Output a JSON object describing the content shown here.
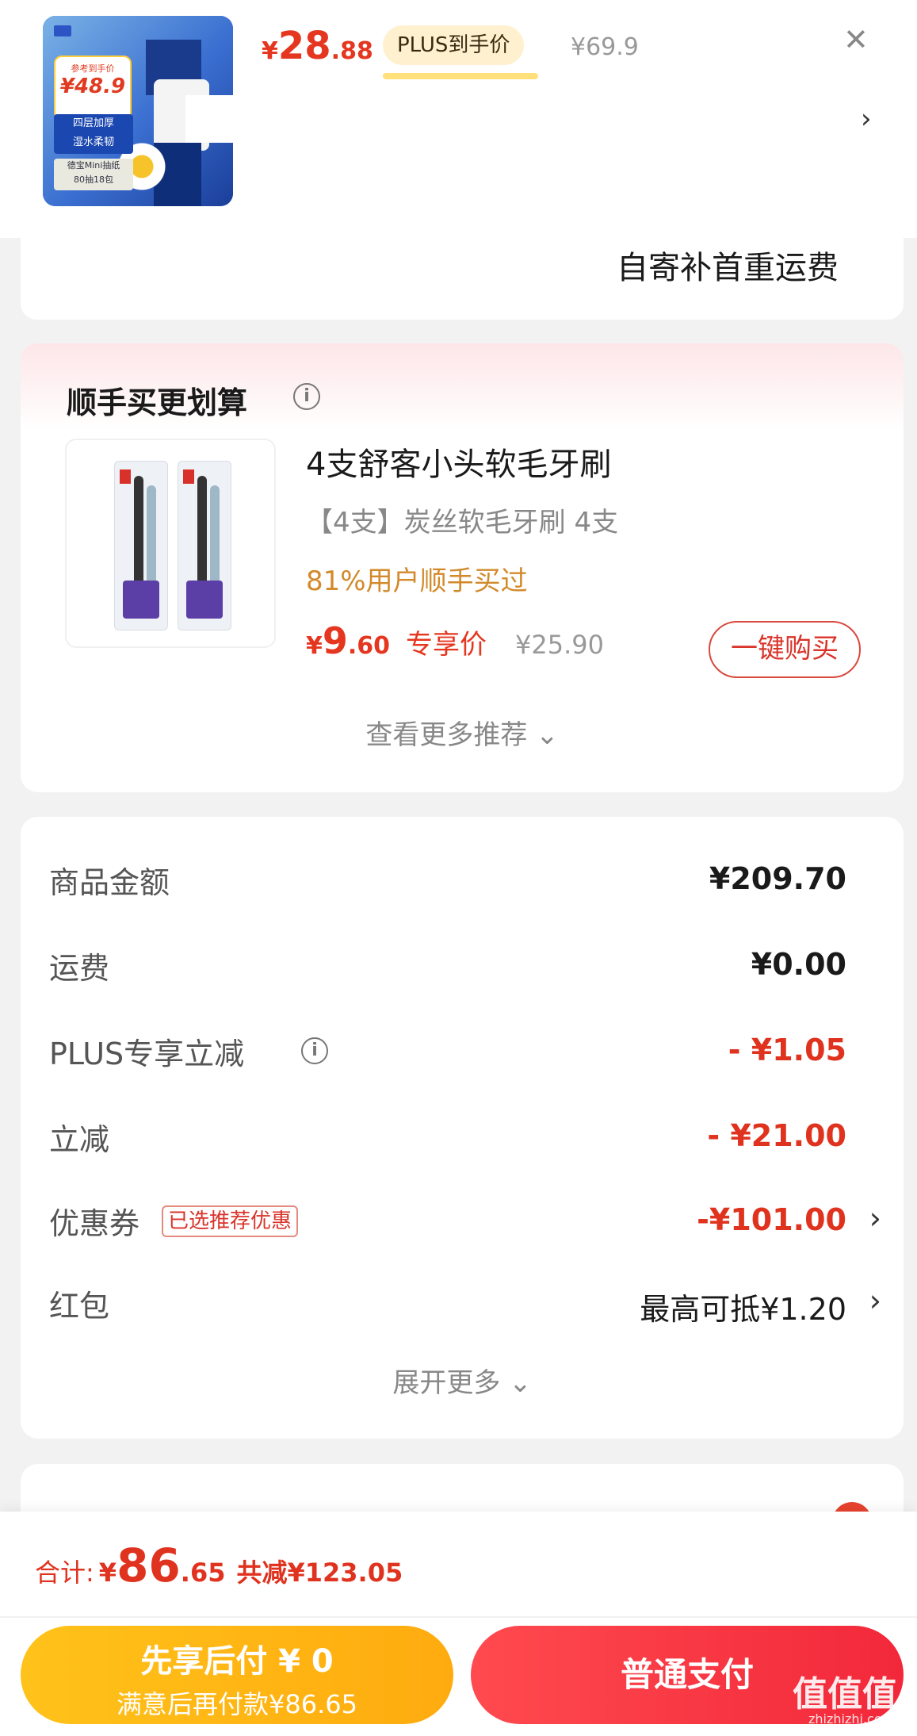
{
  "product": {
    "thumb_tag_label": "参考到手价",
    "thumb_tag_price": "¥48.9",
    "thumb_feature_1": "四层加厚",
    "thumb_feature_2": "湿水柔韧",
    "thumb_spec_1": "德宝Mini抽纸",
    "thumb_spec_2": "80抽18包",
    "price_currency": "¥",
    "price_int": "28",
    "price_dec": ".88",
    "plus_label": "PLUS到手价",
    "original_price": "¥69.9",
    "close_icon": "close-icon",
    "chevron_icon": "chevron-right-icon",
    "shipping_note": "自寄补首重运费"
  },
  "cross_sell": {
    "title": "顺手买更划算",
    "info_icon": "ⓘ",
    "name": "4支舒客小头软毛牙刷",
    "spec": "【4支】炭丝软毛牙刷 4支",
    "bought": "81%用户顺手买过",
    "price_currency": "¥",
    "price_int": "9",
    "price_dec": ".60",
    "exclusive_label": "专享价",
    "original_price": "¥25.90",
    "buy_button": "一键购买",
    "see_more": "查看更多推荐 ⌄"
  },
  "summary": {
    "rows": [
      {
        "label": "商品金额",
        "value": "¥209.70"
      },
      {
        "label": "运费",
        "value": "¥0.00"
      },
      {
        "label": "PLUS专享立减",
        "value": "- ¥1.05"
      },
      {
        "label": "立减",
        "value": "- ¥21.00"
      },
      {
        "label": "优惠券",
        "badge": "已选推荐优惠",
        "value": "-¥101.00"
      },
      {
        "label": "红包",
        "value": "最高可抵¥1.20"
      }
    ],
    "expand_more": "展开更多 ⌄"
  },
  "footer": {
    "total_label": "合计:",
    "total_currency": "¥",
    "total_int": "86",
    "total_dec": ".65",
    "total_saved": "共减¥123.05",
    "pay_later_line1": "先享后付 ¥ 0",
    "pay_later_line2": "满意后再付款¥86.65",
    "pay_normal": "普通支付",
    "watermark": "值值值",
    "watermark_sub": "zhizhizhi.com"
  },
  "colors": {
    "accent_red": "#e5361f",
    "pay_later_yellow": "#ffc21a",
    "pay_normal_red": "#f2283a"
  }
}
